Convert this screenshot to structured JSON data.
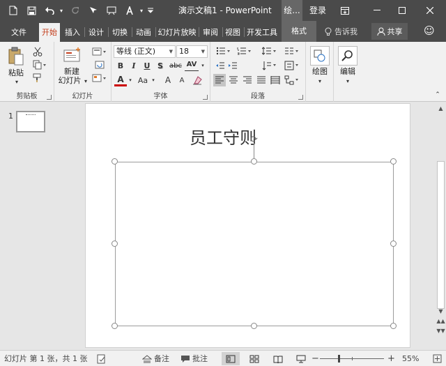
{
  "titlebar": {
    "document_title": "演示文稿1 - PowerPoint",
    "context_tab_group": "绘...",
    "signin_label": "登录"
  },
  "tabs": [
    {
      "label": "文件"
    },
    {
      "label": "开始"
    },
    {
      "label": "插入"
    },
    {
      "label": "设计"
    },
    {
      "label": "切换"
    },
    {
      "label": "动画"
    },
    {
      "label": "幻灯片放映"
    },
    {
      "label": "审阅"
    },
    {
      "label": "视图"
    },
    {
      "label": "开发工具"
    },
    {
      "label": "格式"
    }
  ],
  "tell_me": {
    "label": "告诉我"
  },
  "share": {
    "label": "共享"
  },
  "ribbon": {
    "clipboard": {
      "label": "剪贴板",
      "paste_label": "粘贴"
    },
    "slides": {
      "label": "幻灯片",
      "new_slide_line1": "新建",
      "new_slide_line2": "幻灯片"
    },
    "font": {
      "label": "字体",
      "font_name": "等线 (正文)",
      "font_size": "18",
      "bold": "B",
      "italic": "I",
      "underline": "U",
      "shadow": "S",
      "strikethrough": "abc",
      "spacing": "AV",
      "font_color": "A",
      "change_case": "Aa",
      "grow": "A",
      "shrink": "A"
    },
    "paragraph": {
      "label": "段落"
    },
    "drawing": {
      "label": "绘图"
    },
    "editing": {
      "label": "编辑"
    }
  },
  "slides_pane": {
    "slide_number": "1"
  },
  "slide": {
    "title": "员工守则"
  },
  "statusbar": {
    "slide_info": "幻灯片 第 1 张，共 1 张",
    "notes_label": "备注",
    "comments_label": "批注",
    "zoom_minus": "−",
    "zoom_plus": "+",
    "zoom_level": "55%"
  },
  "colors": {
    "titlebar_bg": "#4a4a4a",
    "active_tab_text": "#c43e1c",
    "ribbon_bg": "#f1f1f1"
  }
}
